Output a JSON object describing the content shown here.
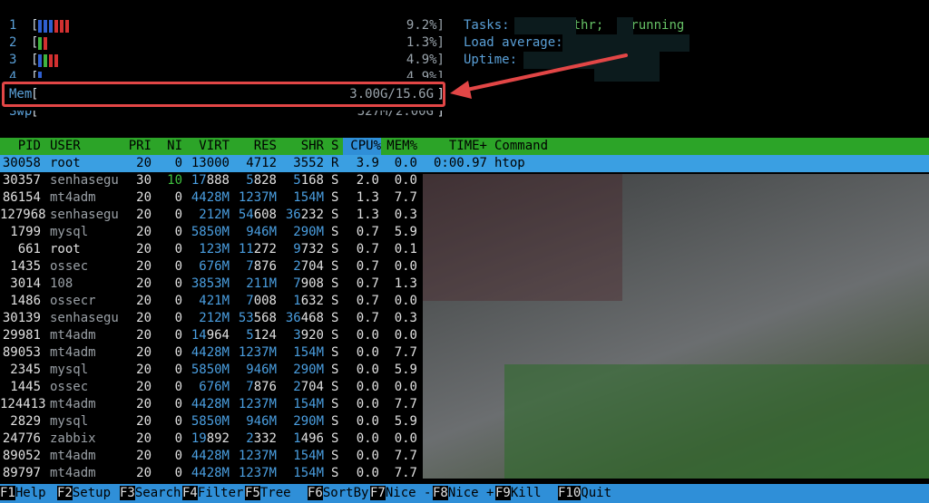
{
  "cpus": [
    {
      "id": "1",
      "bars": [
        [
          "#2f5fd0",
          3
        ],
        [
          "#d23030",
          3
        ]
      ],
      "pct": "9.2%]"
    },
    {
      "id": "2",
      "bars": [
        [
          "#3fb43f",
          1
        ],
        [
          "#d23030",
          1
        ]
      ],
      "pct": "1.3%]"
    },
    {
      "id": "3",
      "bars": [
        [
          "#2f5fd0",
          1
        ],
        [
          "#3fb43f",
          1
        ],
        [
          "#d23030",
          2
        ]
      ],
      "pct": "4.9%]"
    },
    {
      "id": "4",
      "bars": [
        [
          "#2f5fd0",
          1
        ]
      ],
      "pct": "4.9%]"
    }
  ],
  "mem": {
    "label": "Mem",
    "value": "3.00G/15.6G"
  },
  "swp": {
    "label": "Swp",
    "value": "327M/2.00G"
  },
  "info": {
    "tasks_label": "Tasks:",
    "thr": "thr;",
    "running": "running",
    "load_label": "Load average:",
    "uptime_label": "Uptime:"
  },
  "columns": [
    "PID",
    "USER",
    "PRI",
    "NI",
    "VIRT",
    "RES",
    "SHR",
    "S",
    "CPU%",
    "MEM%",
    "TIME+",
    "Command"
  ],
  "rows": [
    [
      "30058",
      "root",
      "20",
      "0",
      "13000",
      "4712",
      "3552",
      "R",
      "3.9",
      "0.0",
      "0:00.97",
      "htop"
    ],
    [
      "30357",
      "senhasegu",
      "30",
      "10",
      "17888",
      "5828",
      "5168",
      "S",
      "2.0",
      "0.0",
      "",
      ""
    ],
    [
      "86154",
      "mt4adm",
      "20",
      "0",
      "4428M",
      "1237M",
      "154M",
      "S",
      "1.3",
      "7.7",
      "",
      ""
    ],
    [
      "127968",
      "senhasegu",
      "20",
      "0",
      "212M",
      "54608",
      "36232",
      "S",
      "1.3",
      "0.3",
      "",
      ""
    ],
    [
      "1799",
      "mysql",
      "20",
      "0",
      "5850M",
      "946M",
      "290M",
      "S",
      "0.7",
      "5.9",
      "",
      ""
    ],
    [
      "661",
      "root",
      "20",
      "0",
      "123M",
      "11272",
      "9732",
      "S",
      "0.7",
      "0.1",
      "",
      ""
    ],
    [
      "1435",
      "ossec",
      "20",
      "0",
      "676M",
      "7876",
      "2704",
      "S",
      "0.7",
      "0.0",
      "",
      ""
    ],
    [
      "3014",
      "108",
      "20",
      "0",
      "3853M",
      "211M",
      "7908",
      "S",
      "0.7",
      "1.3",
      "",
      ""
    ],
    [
      "1486",
      "ossecr",
      "20",
      "0",
      "421M",
      "7008",
      "1632",
      "S",
      "0.7",
      "0.0",
      "",
      ""
    ],
    [
      "30139",
      "senhasegu",
      "20",
      "0",
      "212M",
      "53568",
      "36468",
      "S",
      "0.7",
      "0.3",
      "",
      ""
    ],
    [
      "29981",
      "mt4adm",
      "20",
      "0",
      "14964",
      "5124",
      "3920",
      "S",
      "0.0",
      "0.0",
      "",
      ""
    ],
    [
      "89053",
      "mt4adm",
      "20",
      "0",
      "4428M",
      "1237M",
      "154M",
      "S",
      "0.0",
      "7.7",
      "",
      ""
    ],
    [
      "2345",
      "mysql",
      "20",
      "0",
      "5850M",
      "946M",
      "290M",
      "S",
      "0.0",
      "5.9",
      "",
      ""
    ],
    [
      "1445",
      "ossec",
      "20",
      "0",
      "676M",
      "7876",
      "2704",
      "S",
      "0.0",
      "0.0",
      "",
      ""
    ],
    [
      "124413",
      "mt4adm",
      "20",
      "0",
      "4428M",
      "1237M",
      "154M",
      "S",
      "0.0",
      "7.7",
      "",
      ""
    ],
    [
      "2829",
      "mysql",
      "20",
      "0",
      "5850M",
      "946M",
      "290M",
      "S",
      "0.0",
      "5.9",
      "",
      ""
    ],
    [
      "24776",
      "zabbix",
      "20",
      "0",
      "19892",
      "2332",
      "1496",
      "S",
      "0.0",
      "0.0",
      "",
      ""
    ],
    [
      "89052",
      "mt4adm",
      "20",
      "0",
      "4428M",
      "1237M",
      "154M",
      "S",
      "0.0",
      "7.7",
      "",
      ""
    ],
    [
      "89797",
      "mt4adm",
      "20",
      "0",
      "4428M",
      "1237M",
      "154M",
      "S",
      "0.0",
      "7.7",
      "",
      ""
    ]
  ],
  "footer": [
    {
      "key": "F1",
      "label": "Help"
    },
    {
      "key": "F2",
      "label": "Setup"
    },
    {
      "key": "F3",
      "label": "Search"
    },
    {
      "key": "F4",
      "label": "Filter"
    },
    {
      "key": "F5",
      "label": "Tree"
    },
    {
      "key": "F6",
      "label": "SortBy"
    },
    {
      "key": "F7",
      "label": "Nice -"
    },
    {
      "key": "F8",
      "label": "Nice +"
    },
    {
      "key": "F9",
      "label": "Kill"
    },
    {
      "key": "F10",
      "label": "Quit"
    }
  ]
}
